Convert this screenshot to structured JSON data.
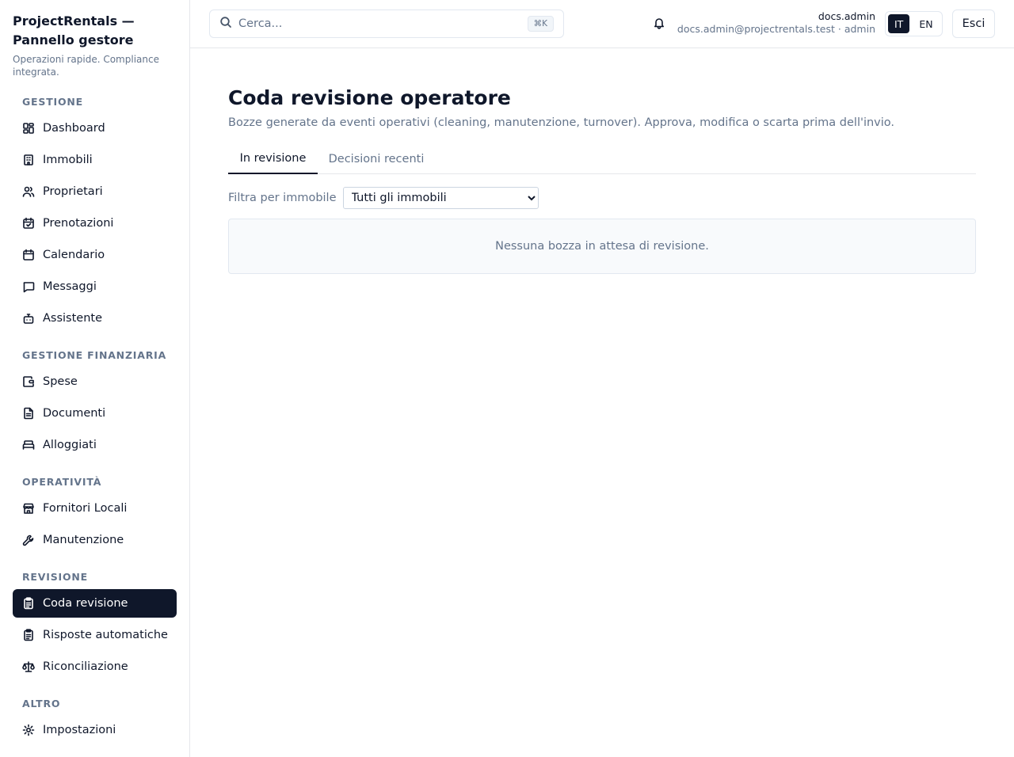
{
  "brand": {
    "title": "ProjectRentals — Pannello gestore",
    "subtitle": "Operazioni rapide. Compliance integrata."
  },
  "sidebar": {
    "sections": [
      {
        "title": "GESTIONE",
        "items": [
          "Dashboard",
          "Immobili",
          "Proprietari",
          "Prenotazioni",
          "Calendario",
          "Messaggi",
          "Assistente"
        ]
      },
      {
        "title": "GESTIONE FINANZIARIA",
        "items": [
          "Spese",
          "Documenti",
          "Alloggiati"
        ]
      },
      {
        "title": "OPERATIVITÀ",
        "items": [
          "Fornitori Locali",
          "Manutenzione"
        ]
      },
      {
        "title": "REVISIONE",
        "items": [
          "Coda revisione",
          "Risposte automatiche",
          "Riconciliazione"
        ]
      },
      {
        "title": "ALTRO",
        "items": [
          "Impostazioni"
        ]
      }
    ],
    "active_item": "Coda revisione"
  },
  "topbar": {
    "search_placeholder": "Cerca...",
    "search_shortcut": "⌘K",
    "user_name": "docs.admin",
    "user_meta": "docs.admin@projectrentals.test · admin",
    "languages": [
      "IT",
      "EN"
    ],
    "active_language": "IT",
    "logout_label": "Esci"
  },
  "main": {
    "title": "Coda revisione operatore",
    "description": "Bozze generate da eventi operativi (cleaning, manutenzione, turnover). Approva, modifica o scarta prima dell'invio.",
    "tabs": [
      "In revisione",
      "Decisioni recenti"
    ],
    "active_tab": "In revisione",
    "filter_label": "Filtra per immobile",
    "filter_value": "Tutti gli immobili",
    "empty_message": "Nessuna bozza in attesa di revisione."
  },
  "colors": {
    "accent": "#0f172a",
    "muted": "#64748b",
    "border": "#e5e7eb"
  }
}
